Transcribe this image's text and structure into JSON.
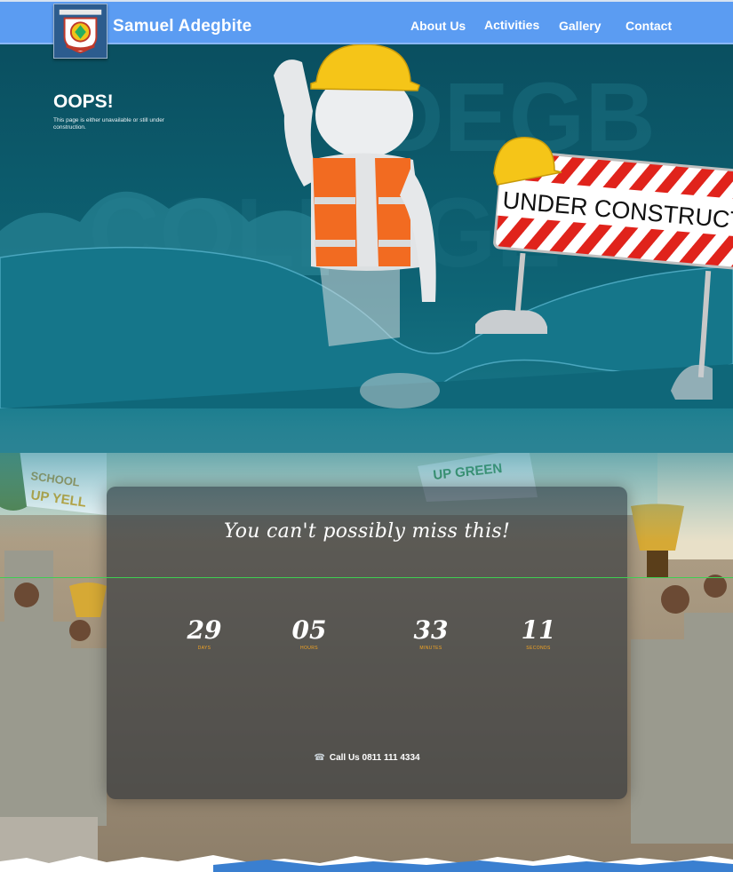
{
  "header": {
    "site_title": "Samuel Adegbite",
    "logo_icon": "school-crest-icon",
    "nav": [
      {
        "label": "About Us"
      },
      {
        "label": "Activities"
      },
      {
        "label": "Gallery"
      },
      {
        "label": "Contact"
      }
    ]
  },
  "hero": {
    "title": "OOPS!",
    "message": "This page is either unavailable or still under construction.",
    "sign_text": "UNDER CONSTRUCTI"
  },
  "countdown": {
    "headline": "You can't possibly miss this!",
    "items": [
      {
        "value": "29",
        "label": "DAYS"
      },
      {
        "value": "05",
        "label": "HOURS"
      },
      {
        "value": "33",
        "label": "MINUTES"
      },
      {
        "value": "11",
        "label": "SECONDS"
      }
    ],
    "call_text": "Call Us 0811 111 4334",
    "call_icon": "phone-icon"
  },
  "colors": {
    "header_bg": "#5b9cf2",
    "hero_bg": "#0b5566",
    "accent_orange": "#f5a623",
    "divider_green": "#3fcf52"
  }
}
